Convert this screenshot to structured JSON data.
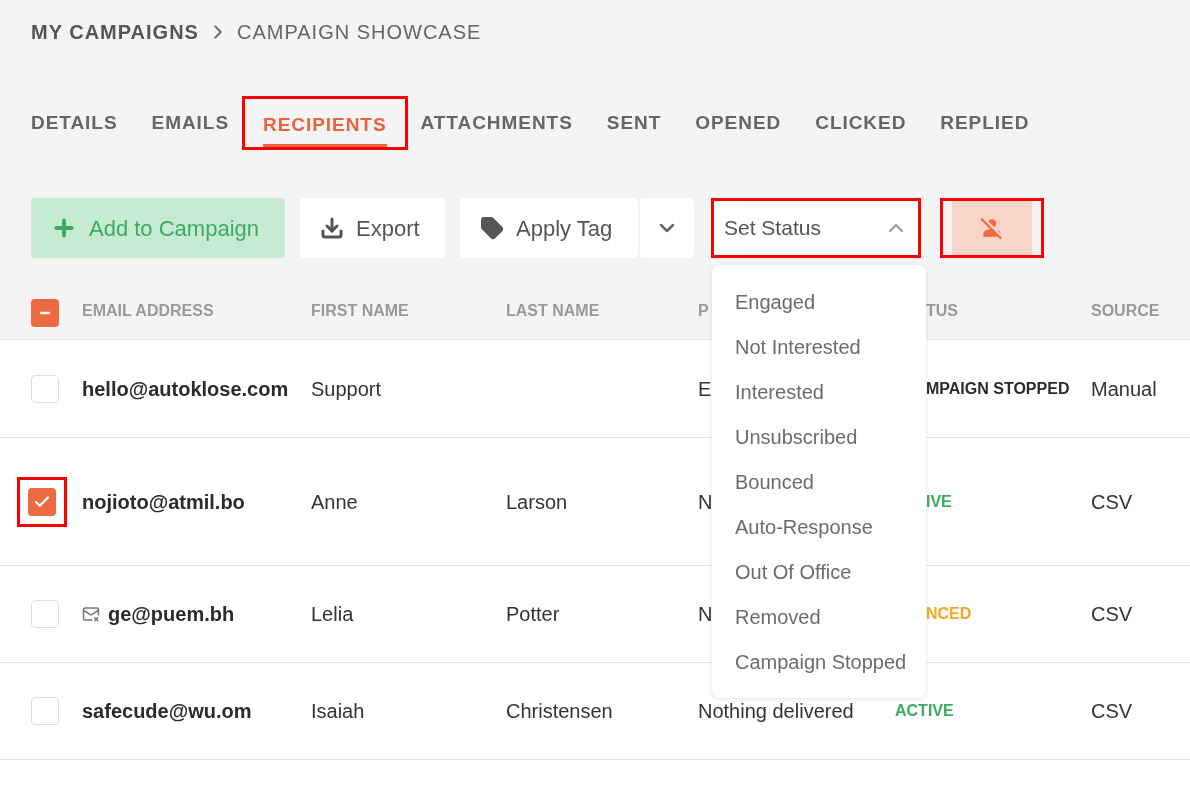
{
  "breadcrumb": [
    {
      "label": "MY CAMPAIGNS",
      "kind": "parent"
    },
    {
      "label": "CAMPAIGN SHOWCASE",
      "kind": "current"
    }
  ],
  "tabs": [
    {
      "label": "DETAILS",
      "selected": false,
      "highlighted": false
    },
    {
      "label": "EMAILS",
      "selected": false,
      "highlighted": false
    },
    {
      "label": "RECIPIENTS",
      "selected": true,
      "highlighted": true
    },
    {
      "label": "ATTACHMENTS",
      "selected": false,
      "highlighted": false
    },
    {
      "label": "SENT",
      "selected": false,
      "highlighted": false
    },
    {
      "label": "OPENED",
      "selected": false,
      "highlighted": false
    },
    {
      "label": "CLICKED",
      "selected": false,
      "highlighted": false
    },
    {
      "label": "REPLIED",
      "selected": false,
      "highlighted": false
    }
  ],
  "toolbar": {
    "add_button": "Add to Campaign",
    "export_button": "Export",
    "tag_button": "Apply Tag",
    "status_select": {
      "label": "Set Status",
      "expanded": true,
      "highlighted": true
    },
    "unassign_button": {
      "highlighted": true
    }
  },
  "status_menu": [
    "Engaged",
    "Not Interested",
    "Interested",
    "Unsubscribed",
    "Bounced",
    "Auto-Response",
    "Out Of Office",
    "Removed",
    "Campaign Stopped"
  ],
  "table": {
    "select_all_partial": true,
    "columns": [
      {
        "label": "EMAIL ADDRESS",
        "kind": "full"
      },
      {
        "label": "FIRST NAME",
        "kind": "full"
      },
      {
        "label": "LAST NAME",
        "kind": "full"
      },
      {
        "label": "P",
        "kind": "full"
      },
      {
        "label": "TUS",
        "kind": "cut"
      },
      {
        "label": "SOURCE",
        "kind": "full"
      }
    ],
    "rows": [
      {
        "checked": false,
        "highlighted": false,
        "undeliverable": false,
        "email": "hello@autoklose.com",
        "first_name": "Support",
        "last_name": "",
        "column_4": "E",
        "status": {
          "text": "MPAIGN STOPPED",
          "kind": "cut",
          "color": "#2b2b2b"
        },
        "source": "Manual"
      },
      {
        "checked": true,
        "highlighted": true,
        "undeliverable": false,
        "email": "nojioto@atmil.bo",
        "first_name": "Anne",
        "last_name": "Larson",
        "column_4": "N",
        "status": {
          "text": "IVE",
          "kind": "cut",
          "color": "#3cab5f"
        },
        "source": "CSV"
      },
      {
        "checked": false,
        "highlighted": false,
        "undeliverable": true,
        "email": "ge@puem.bh",
        "first_name": "Lelia",
        "last_name": "Potter",
        "column_4": "N",
        "status": {
          "text": "NCED",
          "kind": "cut",
          "color": "#f5a623"
        },
        "source": "CSV"
      },
      {
        "checked": false,
        "highlighted": false,
        "undeliverable": false,
        "email": "safecude@wu.om",
        "first_name": "Isaiah",
        "last_name": "Christensen",
        "column_4": "Nothing delivered",
        "status": {
          "text": "ACTIVE",
          "kind": "full",
          "color": "#3cab5f"
        },
        "source": "CSV"
      }
    ]
  }
}
